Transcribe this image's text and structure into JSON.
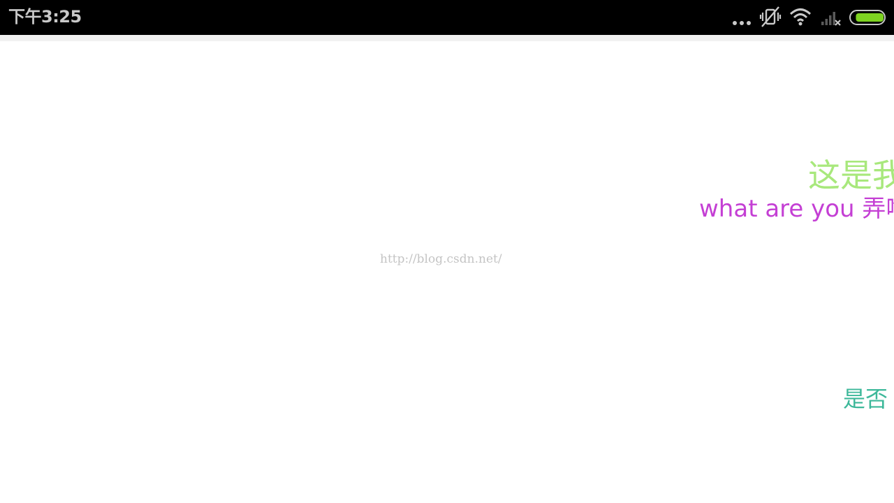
{
  "status_bar": {
    "time": "下午3:25",
    "icons": [
      "more-dots-icon",
      "vibrate-off-icon",
      "wifi-icon",
      "signal-no-sim-icon",
      "battery-icon"
    ],
    "battery_level": 0.9,
    "colors": {
      "background": "#000000",
      "text": "#c9c9c9",
      "battery_fill": "#7ed321"
    }
  },
  "content": {
    "lines": [
      {
        "id": "green",
        "text": "这是我",
        "color": "#a8e87c"
      },
      {
        "id": "purple",
        "text": "what are you 弄啥",
        "color": "#c43fd4"
      },
      {
        "id": "teal",
        "text": "是否",
        "color": "#3db89a"
      }
    ],
    "watermark": "http://blog.csdn.net/"
  }
}
